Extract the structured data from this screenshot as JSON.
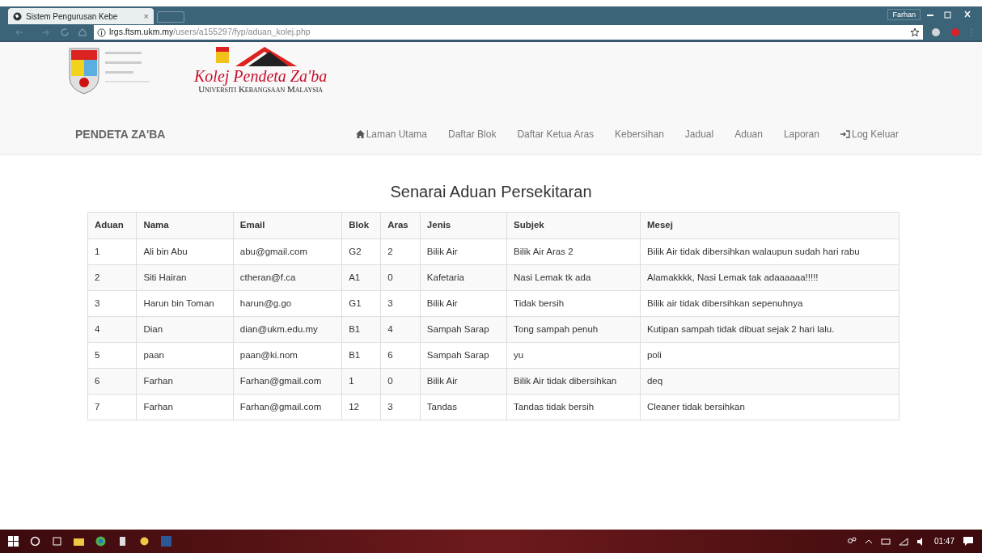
{
  "browser": {
    "tab_title": "Sistem Pengurusan Kebe",
    "tab_close": "×",
    "profile": "Farhan",
    "address": {
      "host": "lrgs.ftsm.ukm.my",
      "path": "/users/a155297/fyp/aduan_kolej.php"
    }
  },
  "header": {
    "logo_title": "Kolej Pendeta Za'ba",
    "logo_subtitle": "Universiti Kebangsaan Malaysia",
    "brand": "PENDETA ZA'BA",
    "nav": [
      {
        "label": "Laman Utama",
        "kind": "home"
      },
      {
        "label": "Daftar Blok",
        "kind": "plain"
      },
      {
        "label": "Daftar Ketua Aras",
        "kind": "plain"
      },
      {
        "label": "Kebersihan",
        "kind": "plain"
      },
      {
        "label": "Jadual",
        "kind": "plain"
      },
      {
        "label": "Aduan",
        "kind": "plain"
      },
      {
        "label": "Laporan",
        "kind": "plain"
      },
      {
        "label": "Log Keluar",
        "kind": "logout"
      }
    ]
  },
  "page_title": "Senarai Aduan Persekitaran",
  "table": {
    "columns": [
      "Aduan",
      "Nama",
      "Email",
      "Blok",
      "Aras",
      "Jenis",
      "Subjek",
      "Mesej"
    ],
    "rows": [
      [
        "1",
        "Ali bin Abu",
        "abu@gmail.com",
        "G2",
        "2",
        "Bilik Air",
        "Bilik Air Aras 2",
        "Bilik Air tidak dibersihkan walaupun sudah hari rabu"
      ],
      [
        "2",
        "Siti Hairan",
        "ctheran@f.ca",
        "A1",
        "0",
        "Kafetaria",
        "Nasi Lemak tk ada",
        "Alamakkkk, Nasi Lemak tak adaaaaaa!!!!!"
      ],
      [
        "3",
        "Harun bin Toman",
        "harun@g.go",
        "G1",
        "3",
        "Bilik Air",
        "Tidak bersih",
        "Bilik air tidak dibersihkan sepenuhnya"
      ],
      [
        "4",
        "Dian",
        "dian@ukm.edu.my",
        "B1",
        "4",
        "Sampah Sarap",
        "Tong sampah penuh",
        "Kutipan sampah tidak dibuat sejak 2 hari lalu."
      ],
      [
        "5",
        "paan",
        "paan@ki.nom",
        "B1",
        "6",
        "Sampah Sarap",
        "yu",
        "poli"
      ],
      [
        "6",
        "Farhan",
        "Farhan@gmail.com",
        "1",
        "0",
        "Bilik Air",
        "Bilik Air tidak dibersihkan",
        "deq"
      ],
      [
        "7",
        "Farhan",
        "Farhan@gmail.com",
        "12",
        "3",
        "Tandas",
        "Tandas tidak bersih",
        "Cleaner tidak bersihkan"
      ]
    ]
  },
  "taskbar": {
    "clock": "01:47"
  }
}
